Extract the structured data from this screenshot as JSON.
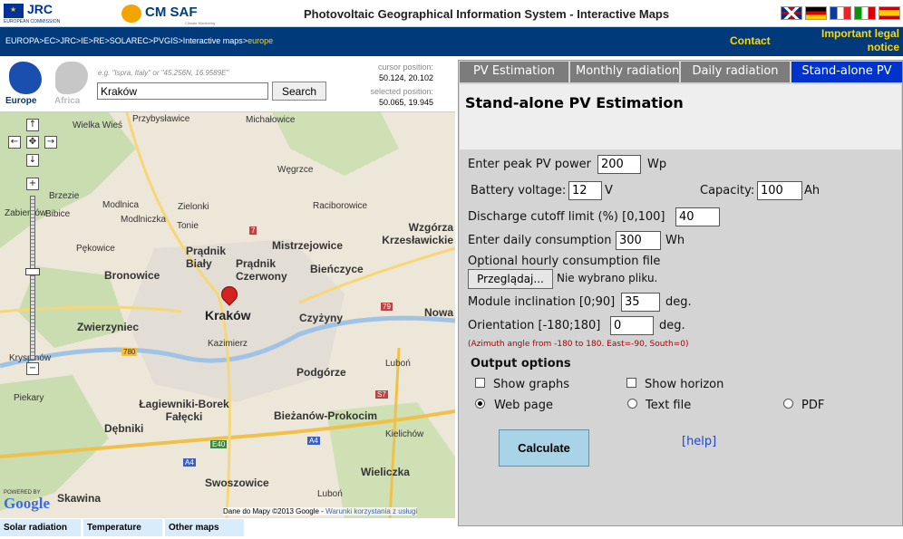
{
  "header": {
    "jrc_label": "JRC",
    "jrc_sub": "EUROPEAN COMMISSION",
    "cmsaf_label": "CM SAF",
    "cmsaf_sub": "Climate Monitoring",
    "app_title": "Photovoltaic Geographical Information System - Interactive Maps",
    "flags": [
      "en",
      "de",
      "fr",
      "it",
      "es"
    ]
  },
  "navbar": {
    "breadcrumb": [
      "EUROPA",
      "EC",
      "JRC",
      "IE",
      "RE",
      "SOLAREC",
      "PVGIS",
      "Interactive maps",
      "europe"
    ],
    "separator": " > ",
    "contact": "Contact",
    "legal": "Important legal notice"
  },
  "search": {
    "europe_label": "Europe",
    "africa_label": "Africa",
    "hint": "e.g. \"Ispra, Italy\" or \"45.256N, 16.9589E\"",
    "location_value": "Kraków",
    "search_button": "Search",
    "cursor_label": "cursor position:",
    "cursor_value": "50.124, 20.102",
    "selected_label": "selected position:",
    "selected_value": "50.065, 19.945"
  },
  "map": {
    "labels": [
      "Michałowice",
      "Przybysławice",
      "Wielka Wieś",
      "Zielonki",
      "Modlnica",
      "Brzezie",
      "Modlniczka",
      "Bibice",
      "Węgrzce",
      "Raciborowice",
      "Pękowice",
      "Zabierzów",
      "Kryspinów",
      "Piekary",
      "Bronowice",
      "Prądnik Biały",
      "Prądnik Czerwony",
      "Mistrzejowice",
      "Bieńczyce",
      "Wzgórza Krzesławickie",
      "Kraków",
      "Czyżyny",
      "Zwierzyniec",
      "Kazimierz",
      "Podgórze",
      "Łagiewniki-Borek Fałęcki",
      "Dębniki",
      "Bieżanów-Prokocim",
      "Swoszowice",
      "Wieliczka",
      "Skawina",
      "Nowa",
      "Tonie",
      "Luboń",
      "Kielichów",
      "Luboń"
    ],
    "roads": [
      "79",
      "780",
      "E40",
      "A4",
      "A4",
      "S7",
      "7"
    ],
    "powered": "POWERED BY",
    "google": "Google",
    "copyright": "Dane do Mapy ©2013 Google -",
    "terms": "Warunki korzystania z usługi"
  },
  "bottom_tabs": [
    "Solar radiation",
    "Temperature",
    "Other maps"
  ],
  "tabs": [
    "PV Estimation",
    "Monthly radiation",
    "Daily radiation",
    "Stand-alone PV"
  ],
  "form": {
    "title": "Stand-alone PV Estimation",
    "peak_label": "Enter peak PV power",
    "peak_value": "200",
    "peak_unit": "Wp",
    "voltage_label": "Battery voltage:",
    "voltage_value": "12",
    "voltage_unit": "V",
    "capacity_label": "Capacity:",
    "capacity_value": "100",
    "capacity_unit": "Ah",
    "cutoff_label": "Discharge cutoff limit (%) [0,100]",
    "cutoff_value": "40",
    "consumption_label": "Enter daily consumption",
    "consumption_value": "300",
    "consumption_unit": "Wh",
    "hourly_label": "Optional hourly consumption file",
    "browse_label": "Przeglądaj...",
    "file_status": "Nie wybrano pliku.",
    "incl_label": "Module inclination [0;90]",
    "incl_value": "35",
    "incl_unit": "deg.",
    "orient_label": "Orientation [-180;180]",
    "orient_value": "0",
    "orient_unit": "deg.",
    "note": "(Azimuth angle from -180 to 180. East=-90, South=0)",
    "output_title": "Output options",
    "show_graphs": "Show graphs",
    "show_horizon": "Show horizon",
    "web_page": "Web page",
    "text_file": "Text file",
    "pdf": "PDF",
    "calculate": "Calculate",
    "help": "[help]"
  }
}
